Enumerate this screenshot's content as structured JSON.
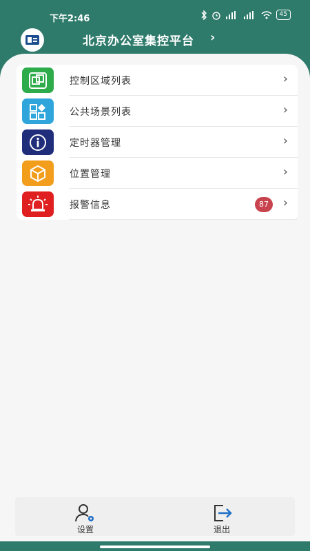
{
  "status_bar": {
    "time": "下午2:46",
    "battery": "45"
  },
  "header": {
    "title": "北京办公室集控平台",
    "chevron": "›"
  },
  "menu": {
    "items": [
      {
        "label": "控制区域列表",
        "icon": "overlap-squares-icon",
        "color": "#2eab4b"
      },
      {
        "label": "公共场景列表",
        "icon": "grid-diamond-icon",
        "color": "#2fa5dc"
      },
      {
        "label": "定时器管理",
        "icon": "info-circle-icon",
        "color": "#1f2d7a"
      },
      {
        "label": "位置管理",
        "icon": "cube-icon",
        "color": "#f39d1c"
      },
      {
        "label": "报警信息",
        "icon": "alarm-siren-icon",
        "color": "#e02020",
        "badge": "87"
      }
    ],
    "chevron": "›"
  },
  "tabbar": {
    "settings_label": "设置",
    "logout_label": "退出"
  },
  "colors": {
    "brand": "#2e7a6b",
    "badge": "#c9434e"
  }
}
